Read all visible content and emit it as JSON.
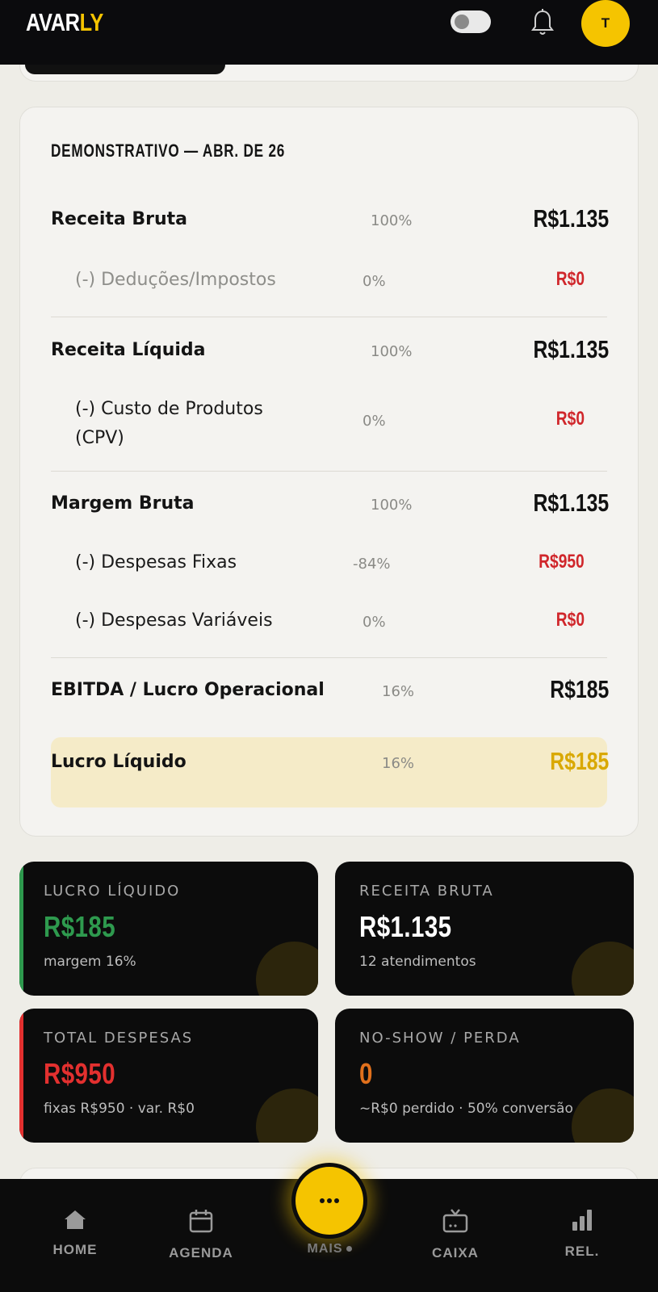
{
  "header": {
    "logo_main": "AVAR",
    "logo_accent": "LY",
    "avatar_initial": "T"
  },
  "statement": {
    "title": "DEMONSTRATIVO — ABR. DE 26",
    "rows": [
      {
        "label": "Receita Bruta",
        "pct": "100%",
        "amount": "R$1.135"
      },
      {
        "label": "(-) Deduções/Impostos",
        "pct": "0%",
        "amount": "R$0"
      },
      {
        "label": "Receita Líquida",
        "pct": "100%",
        "amount": "R$1.135"
      },
      {
        "label_line1": "(-) Custo de Produtos",
        "label_line2": "(CPV)",
        "pct": "0%",
        "amount": "R$0"
      },
      {
        "label": "Margem Bruta",
        "pct": "100%",
        "amount": "R$1.135"
      },
      {
        "label": "(-) Despesas Fixas",
        "pct": "-84%",
        "amount": "R$950"
      },
      {
        "label": "(-) Despesas Variáveis",
        "pct": "0%",
        "amount": "R$0"
      },
      {
        "label": "EBITDA / Lucro Operacional",
        "pct": "16%",
        "amount": "R$185"
      },
      {
        "label": "Lucro Líquido",
        "pct": "16%",
        "amount": "R$185"
      }
    ]
  },
  "kpis": [
    {
      "label": "LUCRO LÍQUIDO",
      "value": "R$185",
      "sub": "margem 16%",
      "value_color": "#2e9a4e",
      "stripe_color": "#2e9a4e"
    },
    {
      "label": "RECEITA BRUTA",
      "value": "R$1.135",
      "sub": "12 atendimentos",
      "value_color": "#ffffff",
      "stripe_color": ""
    },
    {
      "label": "TOTAL DESPESAS",
      "value": "R$950",
      "sub": "fixas R$950 · var. R$0",
      "value_color": "#e3302f",
      "stripe_color": "#e3302f"
    },
    {
      "label": "NO-SHOW / PERDA",
      "value": "0",
      "sub": "~R$0 perdido · 50% conversão",
      "value_color": "#e0701c",
      "stripe_color": ""
    }
  ],
  "nav": {
    "home": "HOME",
    "agenda": "AGENDA",
    "mais": "MAIS",
    "caixa": "CAIXA",
    "rel": "REL."
  },
  "colors": {
    "accent": "#f5c400",
    "negative": "#d0262b",
    "highlight_bg": "#f5ebc8",
    "highlight_value": "#d9a800"
  }
}
